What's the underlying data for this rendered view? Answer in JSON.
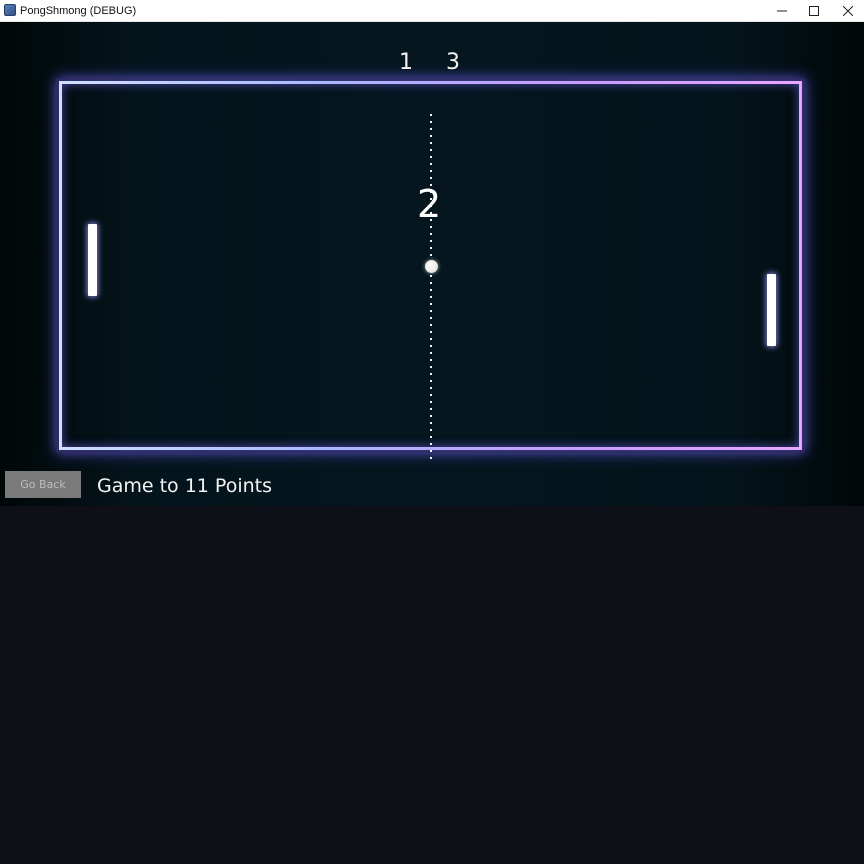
{
  "window": {
    "title": "PongShmong (DEBUG)",
    "controls": [
      "minimize-icon",
      "maximize-icon",
      "close-icon"
    ]
  },
  "game": {
    "score_left": "1",
    "score_right": "3",
    "center_count": "2",
    "ball_icon": "ball-icon",
    "colors": {
      "court_border_left": "#cfe0ff",
      "court_border_right": "#e6a7ff",
      "glow": "#7a6eff",
      "background": "#05161f"
    }
  },
  "footer": {
    "go_back_label": "Go Back",
    "game_goal_text": "Game to 11 Points"
  }
}
